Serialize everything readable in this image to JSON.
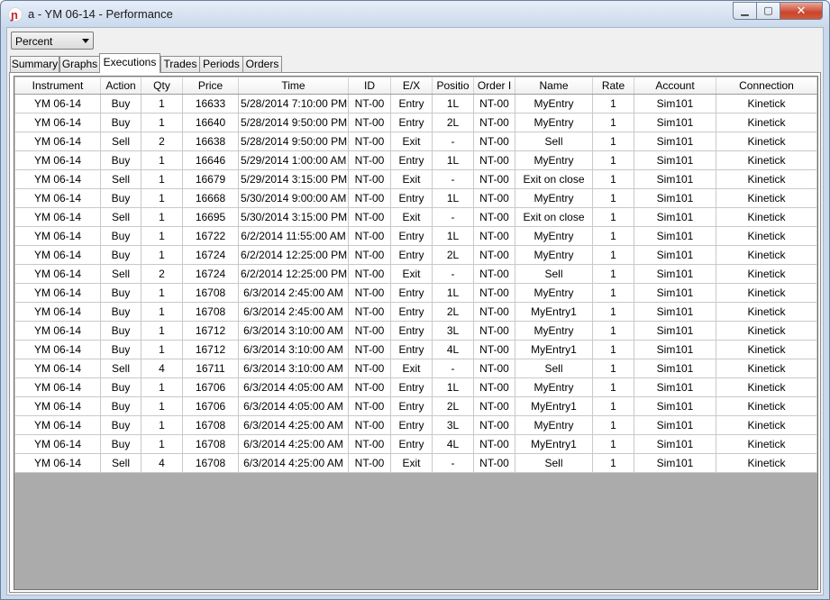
{
  "window": {
    "title": "a - YM 06-14 - Performance",
    "buttons": {
      "minimize": "▁",
      "maximize": "▢",
      "close": "✕"
    }
  },
  "display_mode": {
    "selected": "Percent"
  },
  "tabs": [
    "Summary",
    "Graphs",
    "Executions",
    "Trades",
    "Periods",
    "Orders"
  ],
  "active_tab": "Executions",
  "grid": {
    "columns": [
      "Instrument",
      "Action",
      "Qty",
      "Price",
      "Time",
      "ID",
      "E/X",
      "Positio",
      "Order I",
      "Name",
      "Rate",
      "Account",
      "Connection"
    ],
    "rows": [
      [
        "YM 06-14",
        "Buy",
        "1",
        "16633",
        "5/28/2014 7:10:00 PM",
        "NT-00",
        "Entry",
        "1L",
        "NT-00",
        "MyEntry",
        "1",
        "Sim101",
        "Kinetick"
      ],
      [
        "YM 06-14",
        "Buy",
        "1",
        "16640",
        "5/28/2014 9:50:00 PM",
        "NT-00",
        "Entry",
        "2L",
        "NT-00",
        "MyEntry",
        "1",
        "Sim101",
        "Kinetick"
      ],
      [
        "YM 06-14",
        "Sell",
        "2",
        "16638",
        "5/28/2014 9:50:00 PM",
        "NT-00",
        "Exit",
        "-",
        "NT-00",
        "Sell",
        "1",
        "Sim101",
        "Kinetick"
      ],
      [
        "YM 06-14",
        "Buy",
        "1",
        "16646",
        "5/29/2014 1:00:00 AM",
        "NT-00",
        "Entry",
        "1L",
        "NT-00",
        "MyEntry",
        "1",
        "Sim101",
        "Kinetick"
      ],
      [
        "YM 06-14",
        "Sell",
        "1",
        "16679",
        "5/29/2014 3:15:00 PM",
        "NT-00",
        "Exit",
        "-",
        "NT-00",
        "Exit on close",
        "1",
        "Sim101",
        "Kinetick"
      ],
      [
        "YM 06-14",
        "Buy",
        "1",
        "16668",
        "5/30/2014 9:00:00 AM",
        "NT-00",
        "Entry",
        "1L",
        "NT-00",
        "MyEntry",
        "1",
        "Sim101",
        "Kinetick"
      ],
      [
        "YM 06-14",
        "Sell",
        "1",
        "16695",
        "5/30/2014 3:15:00 PM",
        "NT-00",
        "Exit",
        "-",
        "NT-00",
        "Exit on close",
        "1",
        "Sim101",
        "Kinetick"
      ],
      [
        "YM 06-14",
        "Buy",
        "1",
        "16722",
        "6/2/2014 11:55:00 AM",
        "NT-00",
        "Entry",
        "1L",
        "NT-00",
        "MyEntry",
        "1",
        "Sim101",
        "Kinetick"
      ],
      [
        "YM 06-14",
        "Buy",
        "1",
        "16724",
        "6/2/2014 12:25:00 PM",
        "NT-00",
        "Entry",
        "2L",
        "NT-00",
        "MyEntry",
        "1",
        "Sim101",
        "Kinetick"
      ],
      [
        "YM 06-14",
        "Sell",
        "2",
        "16724",
        "6/2/2014 12:25:00 PM",
        "NT-00",
        "Exit",
        "-",
        "NT-00",
        "Sell",
        "1",
        "Sim101",
        "Kinetick"
      ],
      [
        "YM 06-14",
        "Buy",
        "1",
        "16708",
        "6/3/2014 2:45:00 AM",
        "NT-00",
        "Entry",
        "1L",
        "NT-00",
        "MyEntry",
        "1",
        "Sim101",
        "Kinetick"
      ],
      [
        "YM 06-14",
        "Buy",
        "1",
        "16708",
        "6/3/2014 2:45:00 AM",
        "NT-00",
        "Entry",
        "2L",
        "NT-00",
        "MyEntry1",
        "1",
        "Sim101",
        "Kinetick"
      ],
      [
        "YM 06-14",
        "Buy",
        "1",
        "16712",
        "6/3/2014 3:10:00 AM",
        "NT-00",
        "Entry",
        "3L",
        "NT-00",
        "MyEntry",
        "1",
        "Sim101",
        "Kinetick"
      ],
      [
        "YM 06-14",
        "Buy",
        "1",
        "16712",
        "6/3/2014 3:10:00 AM",
        "NT-00",
        "Entry",
        "4L",
        "NT-00",
        "MyEntry1",
        "1",
        "Sim101",
        "Kinetick"
      ],
      [
        "YM 06-14",
        "Sell",
        "4",
        "16711",
        "6/3/2014 3:10:00 AM",
        "NT-00",
        "Exit",
        "-",
        "NT-00",
        "Sell",
        "1",
        "Sim101",
        "Kinetick"
      ],
      [
        "YM 06-14",
        "Buy",
        "1",
        "16706",
        "6/3/2014 4:05:00 AM",
        "NT-00",
        "Entry",
        "1L",
        "NT-00",
        "MyEntry",
        "1",
        "Sim101",
        "Kinetick"
      ],
      [
        "YM 06-14",
        "Buy",
        "1",
        "16706",
        "6/3/2014 4:05:00 AM",
        "NT-00",
        "Entry",
        "2L",
        "NT-00",
        "MyEntry1",
        "1",
        "Sim101",
        "Kinetick"
      ],
      [
        "YM 06-14",
        "Buy",
        "1",
        "16708",
        "6/3/2014 4:25:00 AM",
        "NT-00",
        "Entry",
        "3L",
        "NT-00",
        "MyEntry",
        "1",
        "Sim101",
        "Kinetick"
      ],
      [
        "YM 06-14",
        "Buy",
        "1",
        "16708",
        "6/3/2014 4:25:00 AM",
        "NT-00",
        "Entry",
        "4L",
        "NT-00",
        "MyEntry1",
        "1",
        "Sim101",
        "Kinetick"
      ],
      [
        "YM 06-14",
        "Sell",
        "4",
        "16708",
        "6/3/2014 4:25:00 AM",
        "NT-00",
        "Exit",
        "-",
        "NT-00",
        "Sell",
        "1",
        "Sim101",
        "Kinetick"
      ]
    ]
  },
  "colors": {
    "grid_empty": "#ababab",
    "close_button": "#c9452b",
    "brand": "#c0242a"
  }
}
